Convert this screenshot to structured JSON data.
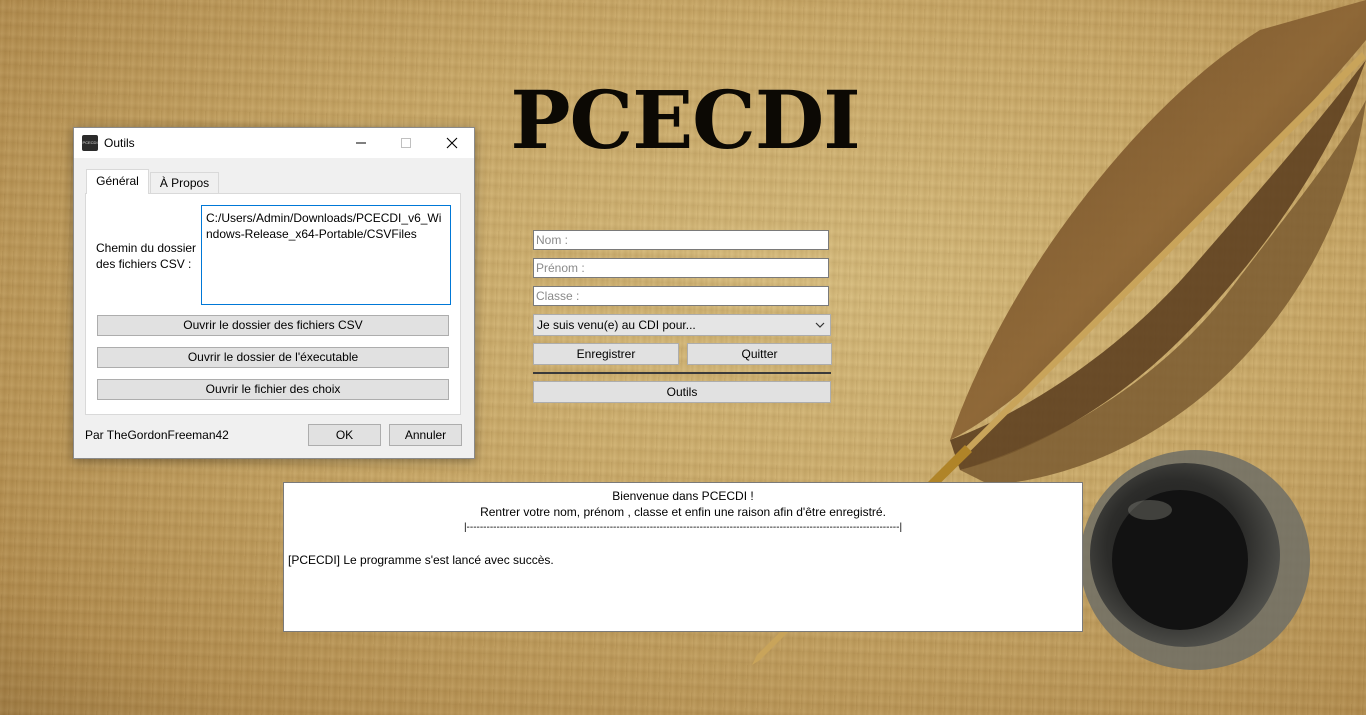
{
  "app": {
    "title": "PCECDI"
  },
  "form": {
    "nom_placeholder": "Nom :",
    "prenom_placeholder": "Prénom :",
    "classe_placeholder": "Classe :",
    "reason_selected": "Je suis venu(e) au CDI pour...",
    "register_label": "Enregistrer",
    "quit_label": "Quitter",
    "tools_label": "Outils"
  },
  "log": {
    "welcome": "Bienvenue dans PCECDI !",
    "instructions": "Rentrer votre nom, prénom , classe et enfin une raison afin d'être enregistré.",
    "separator": "|----------------------------------------------------------------------------------------------------------------------------------|",
    "message": "[PCECDI] Le programme s'est lancé avec succès."
  },
  "dialog": {
    "title": "Outils",
    "app_icon": "PCECDI",
    "tabs": [
      {
        "label": "Général",
        "active": true
      },
      {
        "label": "À Propos",
        "active": false
      }
    ],
    "csv_path_label": "Chemin du dossier des fichiers CSV :",
    "csv_path_value": "C:/Users/Admin/Downloads/PCECDI_v6_Windows-Release_x64-Portable/CSVFiles",
    "buttons": {
      "open_csv": "Ouvrir le dossier des fichiers CSV",
      "open_exe": "Ouvrir le dossier de l'éxecutable",
      "open_choices": "Ouvrir le fichier des choix"
    },
    "credit": "Par TheGordonFreeman42",
    "ok_label": "OK",
    "cancel_label": "Annuler"
  },
  "icons": {
    "minimize": "minimize-icon",
    "maximize": "maximize-icon",
    "close": "close-icon",
    "dropdown": "chevron-down-icon"
  },
  "colors": {
    "focus_border": "#0078d7",
    "title_text": "#0c0904",
    "button_bg": "#e1e1e1"
  }
}
